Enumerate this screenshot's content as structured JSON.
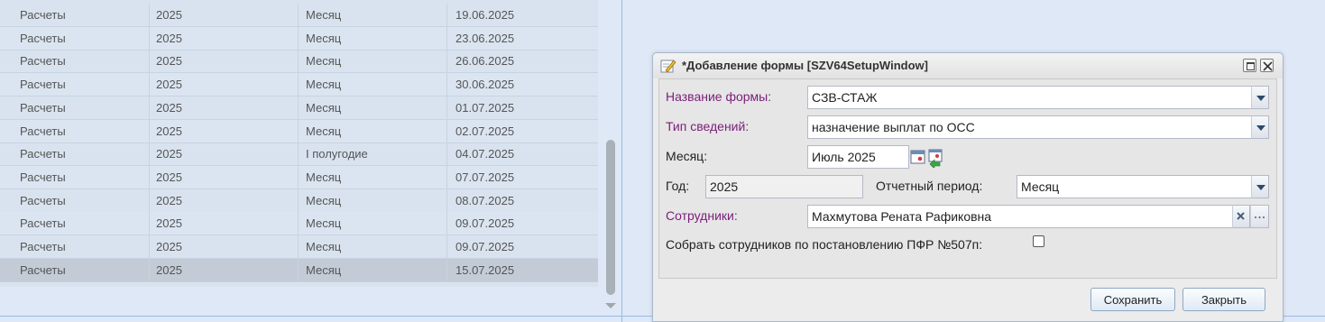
{
  "grid": {
    "rows": [
      {
        "type": "Расчеты",
        "year": "2025",
        "period": "Месяц",
        "date": "19.06.2025"
      },
      {
        "type": "Расчеты",
        "year": "2025",
        "period": "Месяц",
        "date": "23.06.2025"
      },
      {
        "type": "Расчеты",
        "year": "2025",
        "period": "Месяц",
        "date": "26.06.2025"
      },
      {
        "type": "Расчеты",
        "year": "2025",
        "period": "Месяц",
        "date": "30.06.2025"
      },
      {
        "type": "Расчеты",
        "year": "2025",
        "period": "Месяц",
        "date": "01.07.2025"
      },
      {
        "type": "Расчеты",
        "year": "2025",
        "period": "Месяц",
        "date": "02.07.2025"
      },
      {
        "type": "Расчеты",
        "year": "2025",
        "period": "I полугодие",
        "date": "04.07.2025"
      },
      {
        "type": "Расчеты",
        "year": "2025",
        "period": "Месяц",
        "date": "07.07.2025"
      },
      {
        "type": "Расчеты",
        "year": "2025",
        "period": "Месяц",
        "date": "08.07.2025"
      },
      {
        "type": "Расчеты",
        "year": "2025",
        "period": "Месяц",
        "date": "09.07.2025"
      },
      {
        "type": "Расчеты",
        "year": "2025",
        "period": "Месяц",
        "date": "09.07.2025"
      },
      {
        "type": "Расчеты",
        "year": "2025",
        "period": "Месяц",
        "date": "15.07.2025",
        "selected": true
      }
    ]
  },
  "window": {
    "title": "*Добавление формы [SZV64SetupWindow]",
    "form": {
      "form_name_label": "Название формы:",
      "form_name_value": "СЗВ-СТАЖ",
      "info_type_label": "Тип сведений:",
      "info_type_value": "назначение выплат по ОСС",
      "month_label": "Месяц:",
      "month_value": "Июль 2025",
      "year_label": "Год:",
      "year_value": "2025",
      "report_period_label": "Отчетный период:",
      "report_period_value": "Месяц",
      "employees_label": "Сотрудники:",
      "employees_value": "Махмутова Рената Рафиковна",
      "collect_label": "Собрать сотрудников по постановлению ПФР №507п:",
      "collect_checked": false
    },
    "buttons": {
      "save": "Сохранить",
      "close": "Закрыть"
    }
  },
  "colors": {
    "required_label": "#7a1e7a",
    "background": "#dfe8f6"
  }
}
